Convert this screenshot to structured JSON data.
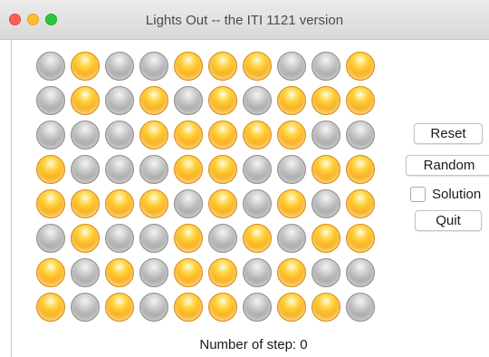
{
  "window": {
    "title": "Lights Out -- the ITI 1121 version"
  },
  "board": {
    "rows": 8,
    "cols": 10,
    "state": [
      [
        0,
        1,
        0,
        0,
        1,
        1,
        1,
        0,
        0,
        1
      ],
      [
        0,
        1,
        0,
        1,
        0,
        1,
        0,
        1,
        1,
        1
      ],
      [
        0,
        0,
        0,
        1,
        1,
        1,
        1,
        1,
        0,
        0
      ],
      [
        1,
        0,
        0,
        0,
        1,
        1,
        0,
        0,
        1,
        1
      ],
      [
        1,
        1,
        1,
        1,
        0,
        1,
        0,
        1,
        0,
        1
      ],
      [
        0,
        1,
        0,
        0,
        1,
        0,
        1,
        0,
        1,
        1
      ],
      [
        1,
        0,
        1,
        0,
        1,
        1,
        0,
        1,
        0,
        0
      ],
      [
        1,
        0,
        1,
        0,
        1,
        1,
        0,
        1,
        1,
        0
      ]
    ],
    "colors": {
      "on": "#f7a81a",
      "off": "#a8a8a8"
    }
  },
  "controls": {
    "reset_label": "Reset",
    "random_label": "Random",
    "solution_label": "Solution",
    "solution_checked": false,
    "quit_label": "Quit"
  },
  "status": {
    "text": "Number of step: 0"
  }
}
